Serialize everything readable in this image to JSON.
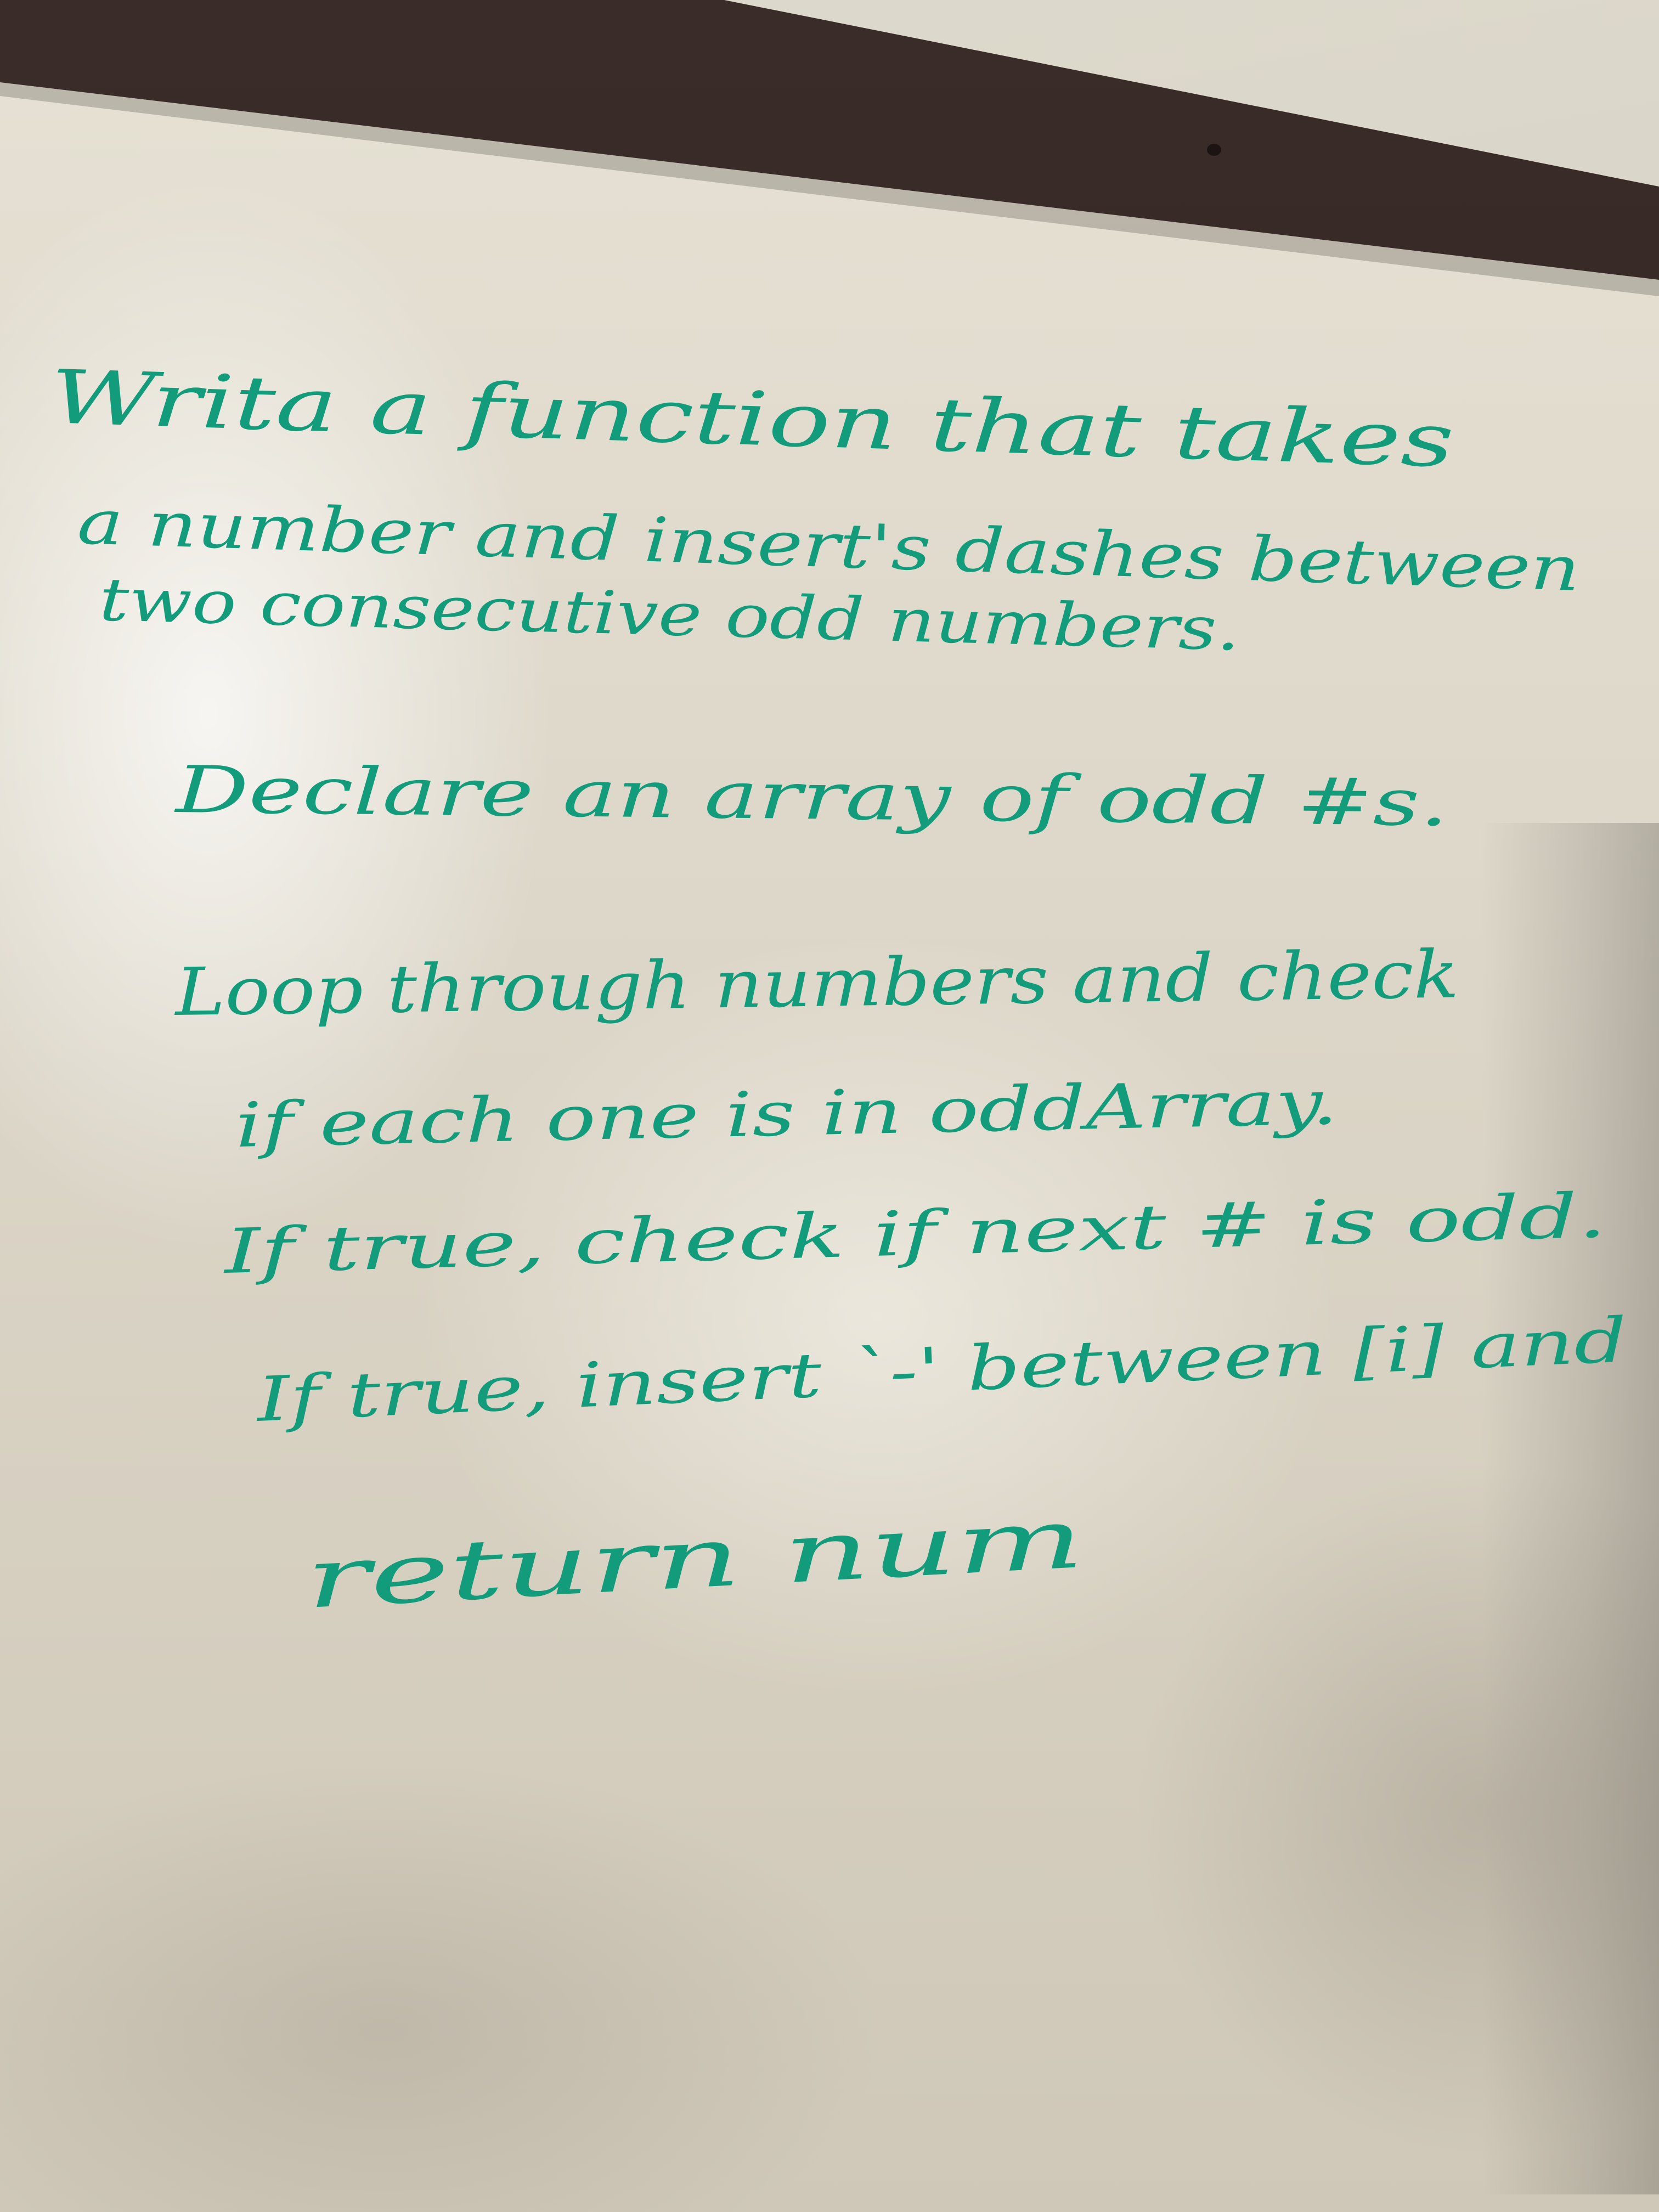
{
  "whiteboard": {
    "ink_color": "#129c7c",
    "lines": [
      "Writa a function that takes",
      "a number and insert's dashes between",
      "two consecutive odd numbers.",
      "Declare an array of odd #s.",
      "Loop through numbers and check",
      "if each one is in oddArray.",
      "If true, check if next # is odd.",
      "If true, insert `-' between [i] and",
      "return num"
    ]
  }
}
